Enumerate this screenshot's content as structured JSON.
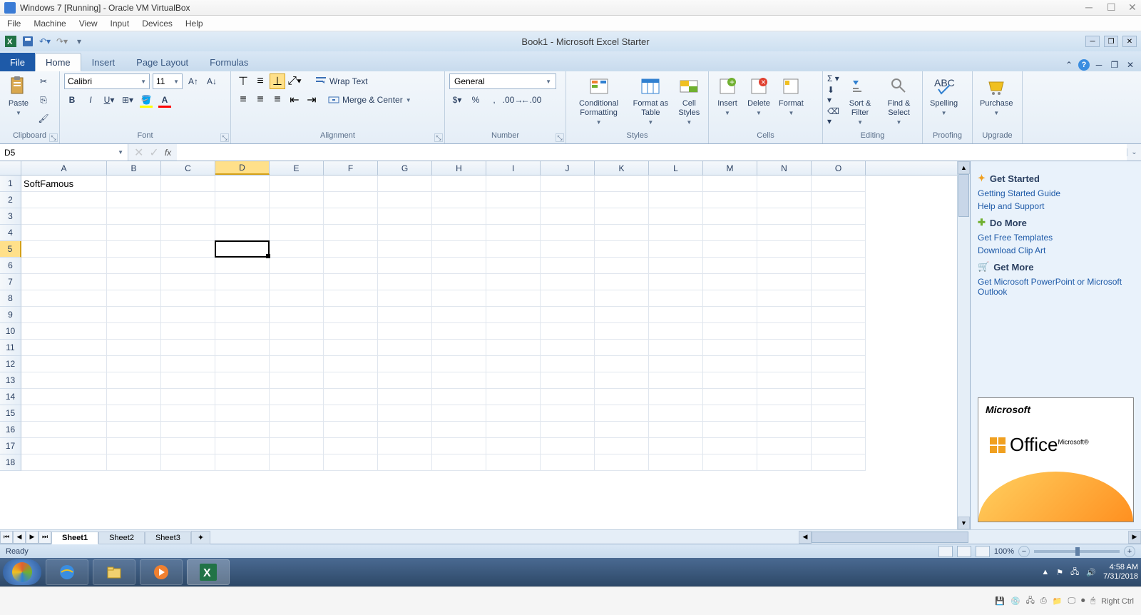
{
  "vbox": {
    "title": "Windows 7 [Running] - Oracle VM VirtualBox",
    "menu": [
      "File",
      "Machine",
      "View",
      "Input",
      "Devices",
      "Help"
    ],
    "status_host_key": "Right Ctrl"
  },
  "excel": {
    "title": "Book1  -  Microsoft Excel Starter",
    "tabs": {
      "file": "File",
      "items": [
        "Home",
        "Insert",
        "Page Layout",
        "Formulas"
      ],
      "active": "Home"
    },
    "ribbon": {
      "clipboard": {
        "paste": "Paste",
        "label": "Clipboard"
      },
      "font": {
        "name": "Calibri",
        "size": "11",
        "label": "Font"
      },
      "alignment": {
        "wrap": "Wrap Text",
        "merge": "Merge & Center",
        "label": "Alignment"
      },
      "number": {
        "format": "General",
        "label": "Number"
      },
      "styles": {
        "cond": "Conditional Formatting",
        "table": "Format as Table",
        "cell": "Cell Styles",
        "label": "Styles"
      },
      "cells": {
        "insert": "Insert",
        "delete": "Delete",
        "format": "Format",
        "label": "Cells"
      },
      "editing": {
        "sort": "Sort & Filter",
        "find": "Find & Select",
        "label": "Editing"
      },
      "proofing": {
        "spell": "Spelling",
        "label": "Proofing"
      },
      "upgrade": {
        "purchase": "Purchase",
        "label": "Upgrade"
      }
    },
    "name_box": "D5",
    "columns": [
      "A",
      "B",
      "C",
      "D",
      "E",
      "F",
      "G",
      "H",
      "I",
      "J",
      "K",
      "L",
      "M",
      "N",
      "O"
    ],
    "selected_col": "D",
    "selected_row": 5,
    "rows_visible": 18,
    "cell_A1": "SoftFamous",
    "sheets": [
      "Sheet1",
      "Sheet2",
      "Sheet3"
    ],
    "active_sheet": "Sheet1",
    "status": "Ready",
    "zoom": "100%"
  },
  "side": {
    "h1": "Get Started",
    "links1": [
      "Getting Started Guide",
      "Help and Support"
    ],
    "h2": "Do More",
    "links2": [
      "Get Free Templates",
      "Download Clip Art"
    ],
    "h3": "Get More",
    "links3": [
      "Get Microsoft PowerPoint or Microsoft Outlook"
    ],
    "ad_brand": "Microsoft",
    "ad_product": "Office"
  },
  "taskbar": {
    "time": "4:58 AM",
    "date": "7/31/2018"
  }
}
